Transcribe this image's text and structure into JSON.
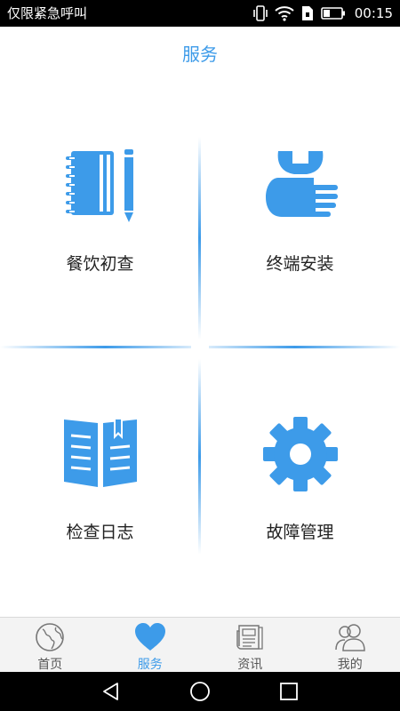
{
  "status_bar": {
    "carrier_text": "仅限紧急呼叫",
    "time": "00:15",
    "icons": [
      "vibrate-icon",
      "wifi-icon",
      "sim-icon",
      "battery-icon"
    ]
  },
  "header": {
    "title": "服务"
  },
  "grid": {
    "items": [
      {
        "label": "餐饮初查",
        "icon": "notebook-pencil-icon"
      },
      {
        "label": "终端安装",
        "icon": "hand-wrench-icon"
      },
      {
        "label": "检查日志",
        "icon": "open-book-icon"
      },
      {
        "label": "故障管理",
        "icon": "gear-icon"
      }
    ]
  },
  "tabs": [
    {
      "label": "首页",
      "icon": "globe-icon",
      "active": false
    },
    {
      "label": "服务",
      "icon": "heart-icon",
      "active": true
    },
    {
      "label": "资讯",
      "icon": "newspaper-icon",
      "active": false
    },
    {
      "label": "我的",
      "icon": "users-icon",
      "active": false
    }
  ],
  "colors": {
    "accent": "#3d9be9",
    "tab_bg": "#f3f3f3",
    "text": "#222222"
  }
}
